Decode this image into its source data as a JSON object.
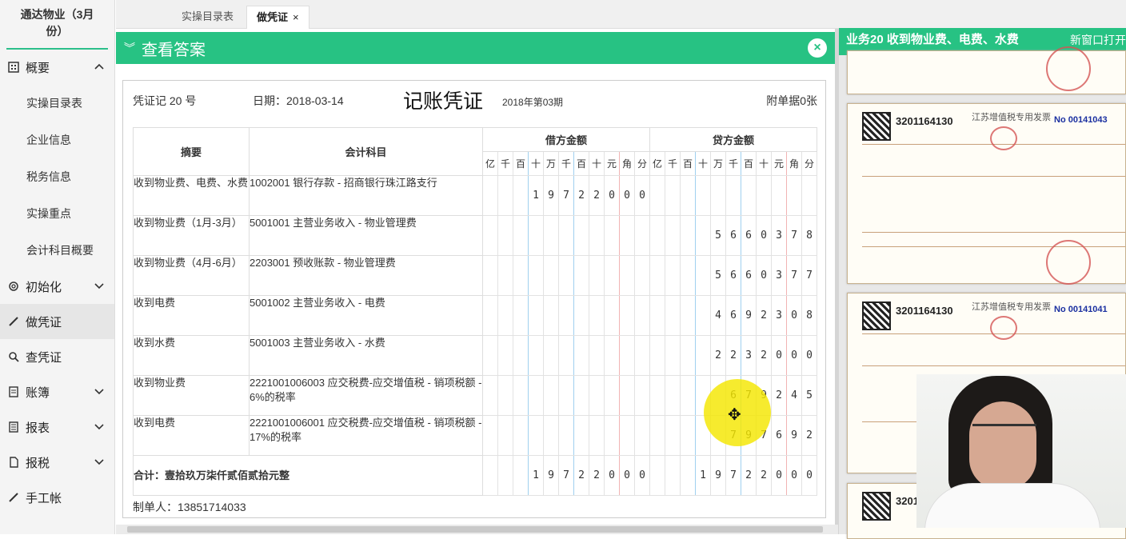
{
  "company": "通达物业（3月份）",
  "nav": {
    "overview": "概要",
    "tasks": "实操目录表",
    "company_info": "企业信息",
    "tax_info": "税务信息",
    "key_points": "实操重点",
    "accounts": "会计科目概要",
    "init": "初始化",
    "make_voucher": "做凭证",
    "query_voucher": "查凭证",
    "ledger": "账簿",
    "reports": "报表",
    "tax": "报税",
    "manual": "手工帐"
  },
  "tabs": {
    "tab1": "实操目录表",
    "tab2": "做凭证",
    "close": "×"
  },
  "answer_bar": {
    "label": "查看答案",
    "close": "×"
  },
  "voucher": {
    "no": "凭证记 20 号",
    "date": "日期：2018-03-14",
    "title": "记账凭证",
    "period": "2018年第03期",
    "attachments": "附单据0张",
    "h_summary": "摘要",
    "h_account": "会计科目",
    "h_debit": "借方金额",
    "h_credit": "贷方金额",
    "units": [
      "亿",
      "千",
      "百",
      "十",
      "万",
      "千",
      "百",
      "十",
      "元",
      "角",
      "分"
    ],
    "rows": [
      {
        "s": "收到物业费、电费、水费",
        "a": "1002001 银行存款 - 招商银行珠江路支行",
        "d": "19722000",
        "c": ""
      },
      {
        "s": "收到物业费（1月-3月）",
        "a": "5001001 主营业务收入 - 物业管理费",
        "d": "",
        "c": "5660378"
      },
      {
        "s": "收到物业费（4月-6月）",
        "a": "2203001 预收账款 - 物业管理费",
        "d": "",
        "c": "5660377"
      },
      {
        "s": "收到电费",
        "a": "5001002 主营业务收入 - 电费",
        "d": "",
        "c": "4692308"
      },
      {
        "s": "收到水费",
        "a": "5001003 主营业务收入 - 水费",
        "d": "",
        "c": "2232000"
      },
      {
        "s": "收到物业费",
        "a": "2221001006003 应交税费-应交增值税 - 销项税额 - 6%的税率",
        "d": "",
        "c": "679245"
      },
      {
        "s": "收到电费",
        "a": "2221001006001 应交税费-应交增值税 - 销项税额 - 17%的税率",
        "d": "",
        "c": "797692"
      }
    ],
    "total_label": "合计：壹拾玖万柒仟贰佰贰拾元整",
    "total_debit": "19722000",
    "total_credit": "19722000",
    "maker": "制单人：13851714033"
  },
  "right": {
    "title": "业务20 收到物业费、电费、水费",
    "new_window": "新窗口打开",
    "inv_code": "3201164130",
    "inv_title": "江苏增值税专用发票",
    "inv_no1": "No 00141043",
    "inv_no2": "No 00141041"
  }
}
